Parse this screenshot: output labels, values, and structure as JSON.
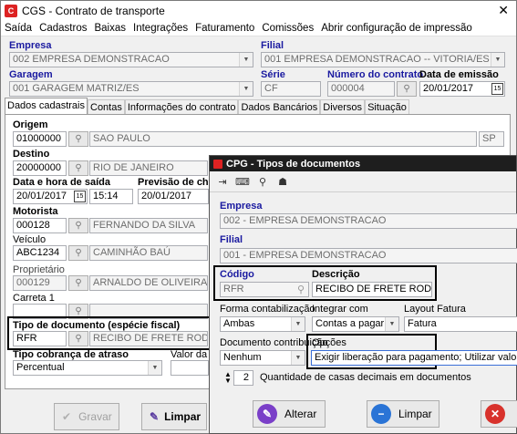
{
  "window": {
    "title": "CGS - Contrato de transporte",
    "close": "✕"
  },
  "menu": [
    "Saída",
    "Cadastros",
    "Baixas",
    "Integrações",
    "Faturamento",
    "Comissões",
    "Abrir configuração de impressão"
  ],
  "header": {
    "empresa_label": "Empresa",
    "empresa_value": "002 EMPRESA DEMONSTRACAO",
    "filial_label": "Filial",
    "filial_value": "001 EMPRESA DEMONSTRACAO -- VITORIA/ES",
    "garagem_label": "Garagem",
    "garagem_value": "001 GARAGEM MATRIZ/ES",
    "serie_label": "Série",
    "serie_value": "CF",
    "numero_label": "Número do contrato",
    "numero_value": "000004",
    "emissao_label": "Data de emissão",
    "emissao_value": "20/01/2017"
  },
  "tabs": [
    "Dados cadastrais",
    "Contas",
    "Informações do contrato",
    "Dados Bancários",
    "Diversos",
    "Situação"
  ],
  "form": {
    "origem_label": "Origem",
    "origem_code": "01000000",
    "origem_city": "SAO PAULO",
    "origem_uf": "SP",
    "destino_label": "Destino",
    "destino_code": "20000000",
    "destino_city": "RIO DE JANEIRO",
    "saida_label": "Data e hora de saída",
    "saida_date": "20/01/2017",
    "saida_time": "15:14",
    "previsao_label": "Previsão de cheg",
    "previsao_date": "20/01/2017",
    "motorista_label": "Motorista",
    "motorista_code": "000128",
    "motorista_name": "FERNANDO DA SILVA",
    "veiculo_label": "Veículo",
    "veiculo_code": "ABC1234",
    "veiculo_name": "CAMINHÃO BAÚ",
    "proprietario_label": "Proprietário",
    "proprietario_code": "000129",
    "proprietario_name": "ARNALDO DE OLIVEIRA",
    "carreta_label": "Carreta 1",
    "tipo_doc_label": "Tipo de documento (espécie fiscal)",
    "tipo_doc_code": "RFR",
    "tipo_doc_name": "RECIBO DE FRETE RODOVIAR",
    "cobranca_label": "Tipo cobrança de atraso",
    "cobranca_value": "Percentual",
    "valor_label": "Valor da m"
  },
  "footer": {
    "gravar": "Gravar",
    "limpar": "Limpar"
  },
  "dialog": {
    "title": "CPG - Tipos de documentos",
    "empresa_label": "Empresa",
    "empresa_value": "002 - EMPRESA DEMONSTRACAO",
    "filial_label": "Filial",
    "filial_value": "001 - EMPRESA DEMONSTRACAO",
    "codigo_label": "Código",
    "codigo_value": "RFR",
    "descricao_label": "Descrição",
    "descricao_value": "RECIBO DE FRETE RODOVIARIO",
    "forma_label": "Forma contabilização",
    "forma_value": "Ambas",
    "integrar_label": "Integrar com",
    "integrar_value": "Contas a pagar",
    "layout_label": "Layout Fatura",
    "layout_value": "Fatura",
    "doc_contrib_label": "Documento contribuição",
    "doc_contrib_value": "Nenhum",
    "opcoes_label": "Opções",
    "opcoes_value": "Exigir liberação para pagamento; Utilizar valores complen",
    "casas_value": "2",
    "casas_label": "Quantidade de casas decimais em documentos",
    "alterar": "Alterar",
    "limpar": "Limpar"
  }
}
